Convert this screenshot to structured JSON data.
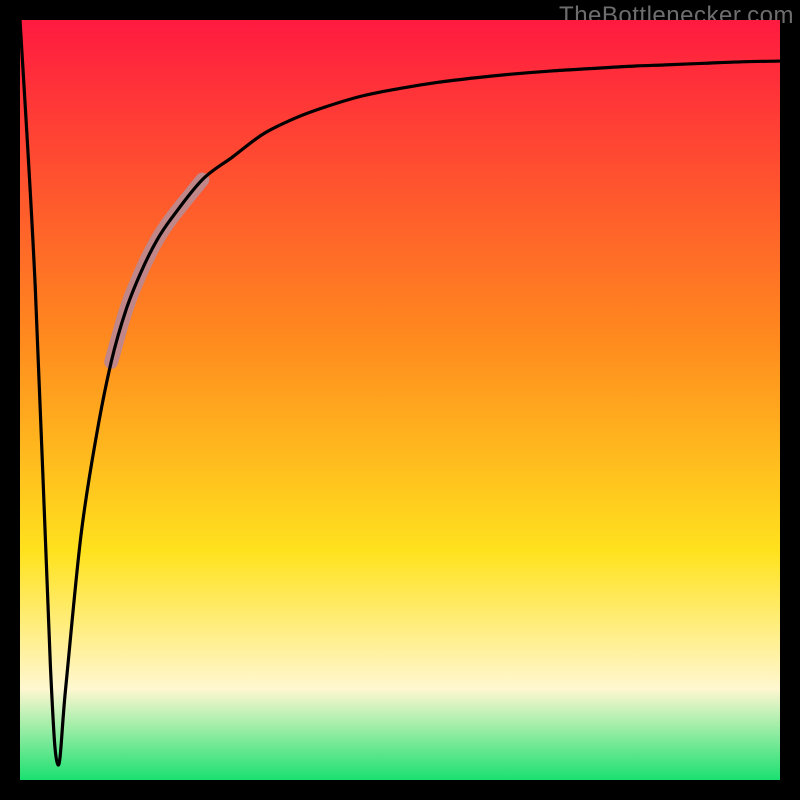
{
  "attribution": "TheBottlenecker.com",
  "colors": {
    "border": "#000000",
    "gradient_top": "#ff1a40",
    "gradient_mid1": "#ff8a1e",
    "gradient_mid2": "#ffe21e",
    "gradient_cream": "#fff7d0",
    "gradient_bottom": "#1ae070",
    "curve": "#000000",
    "highlight": "#c08688"
  },
  "chart_data": {
    "type": "line",
    "title": "",
    "xlabel": "",
    "ylabel": "",
    "xlim": [
      0,
      100
    ],
    "ylim": [
      0,
      100
    ],
    "grid": false,
    "legend": false,
    "x": [
      0,
      2,
      4,
      5,
      6,
      8,
      10,
      12,
      14,
      16,
      18,
      20,
      24,
      28,
      32,
      36,
      40,
      45,
      50,
      55,
      60,
      65,
      70,
      75,
      80,
      85,
      90,
      95,
      100
    ],
    "y": [
      100,
      65,
      15,
      2,
      12,
      32,
      45,
      55,
      62,
      67,
      71,
      74,
      79,
      82,
      85,
      87,
      88.5,
      90,
      91,
      91.8,
      92.4,
      92.9,
      93.3,
      93.6,
      93.9,
      94.1,
      94.3,
      94.5,
      94.6
    ],
    "highlight_range_x": [
      14,
      22
    ]
  }
}
